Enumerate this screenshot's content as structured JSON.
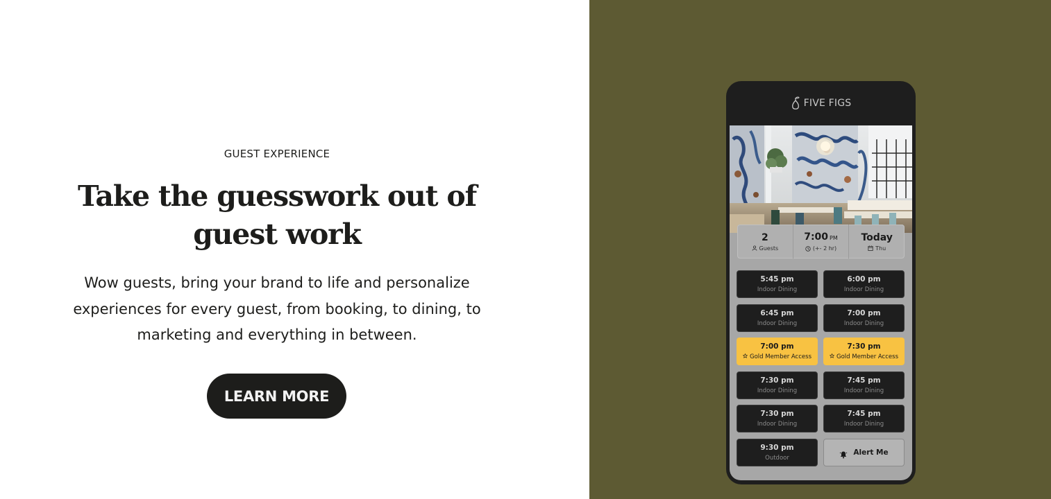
{
  "hero_section": {
    "eyebrow": "GUEST EXPERIENCE",
    "headline": "Take the guesswork out of guest work",
    "body": "Wow guests, bring your brand to life and personalize experiences for every guest, from booking, to dining, to marketing and everything in between.",
    "cta_label": "LEARN MORE"
  },
  "colors": {
    "panel_background": "#5d5a33",
    "cta_background": "#1d1d1b",
    "gold_slot": "#f8c242"
  },
  "phone": {
    "brand_name": "FIVE FIGS",
    "booking": {
      "guests_value": "2",
      "guests_label": "Guests",
      "time_value": "7:00",
      "time_ampm": "PM",
      "time_label": "(+- 2 hr)",
      "date_value": "Today",
      "date_label": "Thu"
    },
    "slots": [
      {
        "time": "5:45 pm",
        "type": "Indoor Dining"
      },
      {
        "time": "6:00 pm",
        "type": "Indoor Dining"
      },
      {
        "time": "6:45 pm",
        "type": "Indoor Dining"
      },
      {
        "time": "7:00 pm",
        "type": "Indoor Dining"
      },
      {
        "time": "7:00 pm",
        "type": "Gold Member Access"
      },
      {
        "time": "7:30 pm",
        "type": "Gold Member Access"
      },
      {
        "time": "7:30 pm",
        "type": "Indoor Dining"
      },
      {
        "time": "7:45 pm",
        "type": "Indoor Dining"
      },
      {
        "time": "7:30 pm",
        "type": "Indoor Dining"
      },
      {
        "time": "7:45 pm",
        "type": "Indoor Dining"
      },
      {
        "time": "9:30 pm",
        "type": "Outdoor"
      }
    ],
    "alert_label": "Alert Me",
    "icons": {
      "logo": "fig-logo-icon",
      "guests": "person-icon",
      "time": "clock-icon",
      "date": "calendar-icon",
      "gold": "star-icon",
      "alert": "bell-icon"
    }
  }
}
